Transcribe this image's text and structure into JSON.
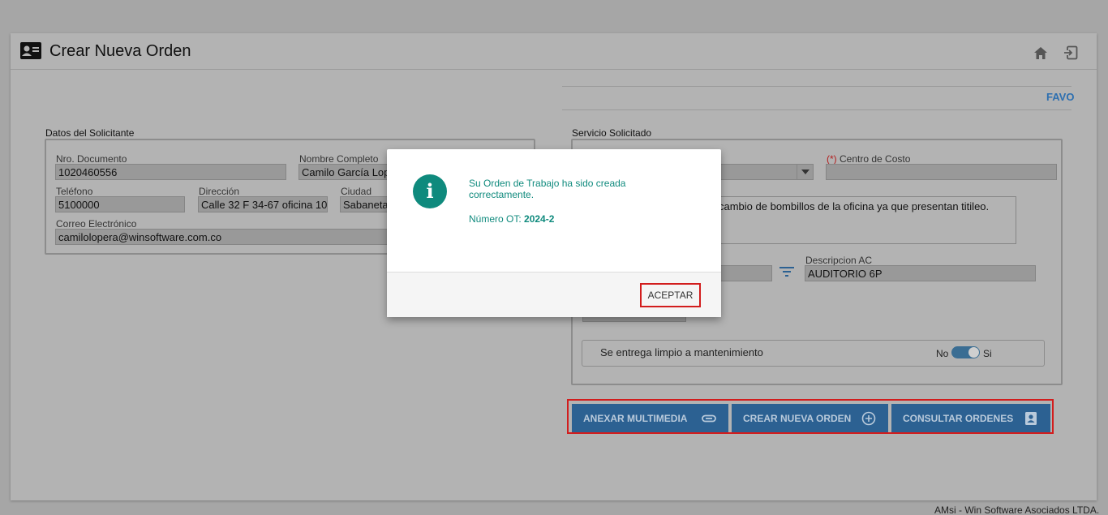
{
  "header": {
    "title": "Crear Nueva Orden"
  },
  "favorites_tab": "FAVO",
  "solicitante": {
    "section_title": "Datos del Solicitante",
    "doc_label": "Nro. Documento",
    "doc_value": "1020460556",
    "name_label": "Nombre Completo",
    "name_value": "Camilo García Lopera",
    "phone_label": "Teléfono",
    "phone_value": "5100000",
    "address_label": "Dirección",
    "address_value": "Calle 32 F 34-67 oficina 10",
    "city_label": "Ciudad",
    "city_value": "Sabaneta",
    "email_label": "Correo Electrónico",
    "email_value": "camilolopera@winsoftware.com.co"
  },
  "servicio": {
    "section_title": "Servicio Solicitado",
    "req_mark": "(*)",
    "cost_center_label": " Centro de Costo",
    "cost_center_value": "",
    "description_text": "cambio de bombillos de la oficina ya que presentan titileo.",
    "desc_ac_label": "Descripcion AC",
    "desc_ac_value": "AUDITORIO 6P",
    "toggle_label": "Se entrega limpio a mantenimiento",
    "toggle_no": "No",
    "toggle_si": "Si",
    "toggle_on": true
  },
  "buttons": {
    "attach": "ANEXAR MULTIMEDIA",
    "create": "CREAR NUEVA ORDEN",
    "consult": "CONSULTAR ORDENES"
  },
  "modal": {
    "message": "Su Orden de Trabajo ha sido creada correctamente.",
    "ot_label": "Número OT: ",
    "ot_value": "2024-2",
    "accept": "ACEPTAR"
  },
  "footer": "AMsi - Win Software Asociados LTDA.",
  "colors": {
    "primary_button": "#2c6192",
    "modal_accent": "#0f8a7d",
    "highlight_border": "#d21d1d"
  }
}
